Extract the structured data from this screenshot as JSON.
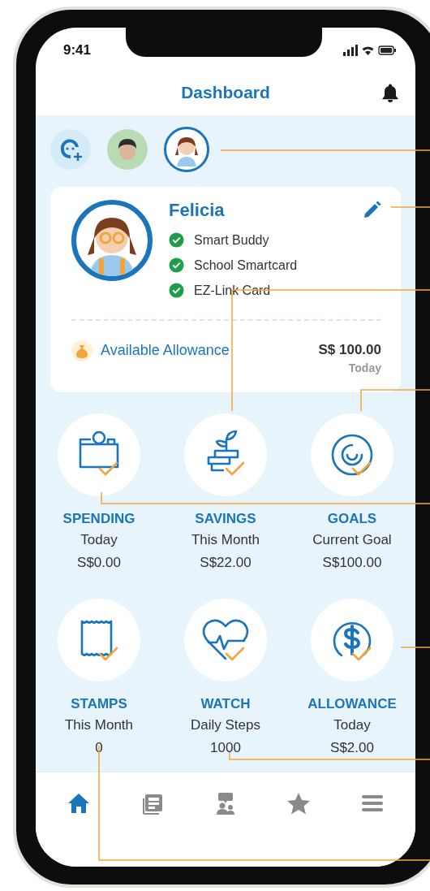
{
  "status_bar": {
    "time": "9:41"
  },
  "header": {
    "title": "Dashboard"
  },
  "profiles": [
    {
      "kind": "add",
      "selected": false
    },
    {
      "kind": "boy",
      "selected": false
    },
    {
      "kind": "girl",
      "selected": true
    }
  ],
  "profile_card": {
    "name": "Felicia",
    "linked": [
      {
        "label": "Smart Buddy",
        "checked": true
      },
      {
        "label": "School Smartcard",
        "checked": true
      },
      {
        "label": "EZ-Link Card",
        "checked": true
      }
    ],
    "allowance": {
      "label": "Available Allowance",
      "amount": "S$ 100.00",
      "period": "Today"
    }
  },
  "tiles": [
    {
      "kind": "spending",
      "title": "SPENDING",
      "subtitle": "Today",
      "value": "S$0.00"
    },
    {
      "kind": "savings",
      "title": "SAVINGS",
      "subtitle": "This Month",
      "value": "S$22.00"
    },
    {
      "kind": "goals",
      "title": "GOALS",
      "subtitle": "Current Goal",
      "value": "S$100.00"
    },
    {
      "kind": "stamps",
      "title": "STAMPS",
      "subtitle": "This Month",
      "value": "0"
    },
    {
      "kind": "watch",
      "title": "WATCH",
      "subtitle": "Daily Steps",
      "value": "1000"
    },
    {
      "kind": "allowance",
      "title": "ALLOWANCE",
      "subtitle": "Today",
      "value": "S$2.00"
    }
  ],
  "nav": [
    {
      "kind": "home",
      "selected": true
    },
    {
      "kind": "news",
      "selected": false
    },
    {
      "kind": "community",
      "selected": false
    },
    {
      "kind": "favourites",
      "selected": false
    },
    {
      "kind": "menu",
      "selected": false
    }
  ]
}
